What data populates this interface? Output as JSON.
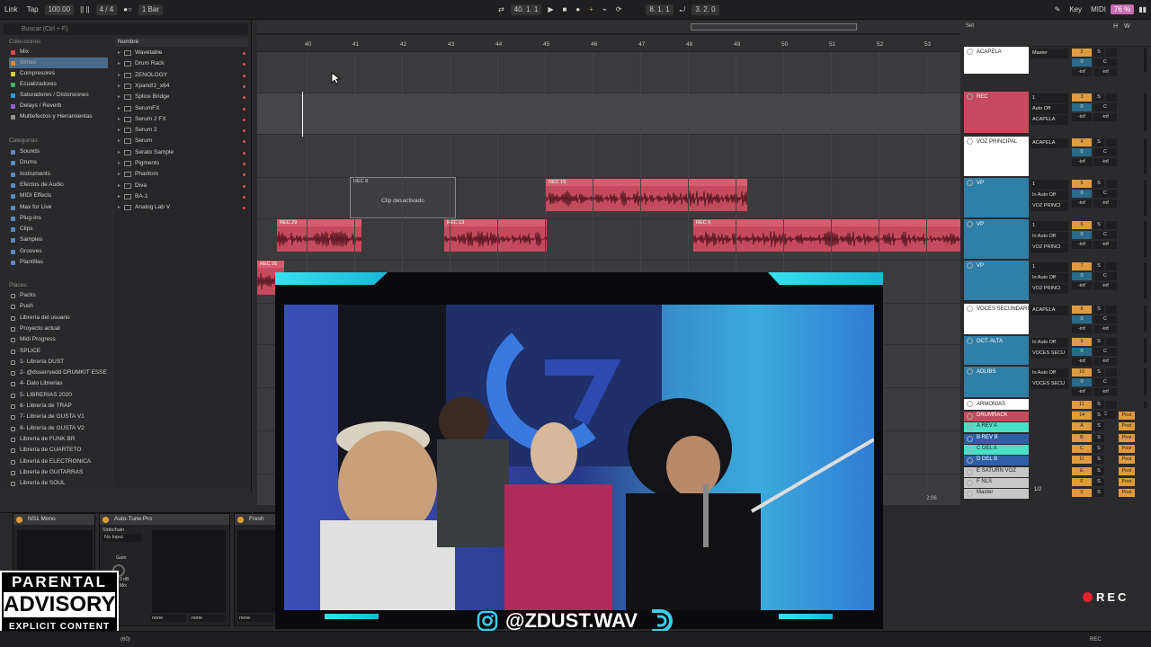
{
  "transport": {
    "link": "Link",
    "tap": "Tap",
    "bpm": "100.00",
    "sig": "4 / 4",
    "metro": "1 Bar",
    "position": "40.  1.  1",
    "loop_start": "8.  1.  1",
    "loop_len": "3.  2.  0",
    "key": "Key",
    "midi": "MIDI",
    "cpu": "76 %",
    "h": "H",
    "w": "W"
  },
  "browser": {
    "search_placeholder": "Buscar (Ctrl + F)",
    "collections_header": "Colecciones",
    "collections": [
      {
        "label": "Mix",
        "color": "#e04848"
      },
      {
        "label": "Sintes",
        "color": "#e08a30",
        "selected": true
      },
      {
        "label": "Compresores",
        "color": "#d8d040"
      },
      {
        "label": "Ecualizadores",
        "color": "#40b060"
      },
      {
        "label": "Saturadores / Distorsiones",
        "color": "#3098d8"
      },
      {
        "label": "Delays / Reverb",
        "color": "#9060d0"
      },
      {
        "label": "Multiefectos y Herramientas",
        "color": "#909090"
      }
    ],
    "categories_header": "Categorías",
    "categories": [
      "Sounds",
      "Drums",
      "Instruments",
      "Efectos de Audio",
      "MIDI Effects",
      "Max for Live",
      "Plug-Ins",
      "Clips",
      "Samples",
      "Grooves",
      "Plantillas"
    ],
    "places_header": "Places",
    "places": [
      "Packs",
      "Push",
      "Librería del usuario",
      "Proyecto actual",
      "Midi Progress",
      "SPLICE",
      "1- Librería DUST",
      "2- @dsserrvedd DRUMKIT ESSE",
      "4- Dalo Librerias",
      "5- LIBRERIAS 2020",
      "6- Librería de TRAP",
      "7- Librería de GUSTA V1",
      "8- Librería de GUSTA V2",
      "Librería de FUNK BR",
      "Librería de CUARTETO",
      "Librería de ELECTRONICA",
      "Librería de GUITARRAS",
      "Librería de SOUL"
    ],
    "name_header": "Nombre",
    "names": [
      "Wavetable",
      "Drum Rack",
      "ZENOLOGY",
      "Xpand!2_x64",
      "Splice Bridge",
      "SerumFX",
      "Serum 2 FX",
      "Serum 2",
      "Serum",
      "Serato Sample",
      "Pigments",
      "Phantom",
      "Diva",
      "BA-1",
      "Analog Lab V"
    ]
  },
  "arrangement": {
    "bars": [
      "40",
      "41",
      "42",
      "43",
      "44",
      "45",
      "46",
      "47",
      "48",
      "49",
      "50",
      "51",
      "52",
      "53"
    ],
    "clips": [
      {
        "name": "REC 8",
        "disabled": true,
        "message": "Clip desactivado"
      },
      {
        "name": "REC 15"
      },
      {
        "name": "REC 29"
      },
      {
        "name": "REC 13"
      },
      {
        "name": "REC 9"
      },
      {
        "name": "REC 26"
      }
    ],
    "time_marker": "2:06"
  },
  "mixer": {
    "set_label": "Set",
    "tracks": [
      {
        "name": "ACAPELA",
        "color": "#ffffff",
        "io": [
          "Master"
        ],
        "vol": "2"
      },
      {
        "name": "REC",
        "color": "#c64a5d",
        "io": [
          "1",
          "Auto  Off",
          "ACAPELA"
        ],
        "vol": "3"
      },
      {
        "name": "VOZ PRINCIPAL",
        "color": "#ffffff",
        "io": [
          "ACAPELA"
        ],
        "vol": "4"
      },
      {
        "name": "VP",
        "color": "#2f7fa8",
        "io": [
          "1",
          "In  Auto  Off",
          "VOZ PRINCI"
        ],
        "vol": "5"
      },
      {
        "name": "VP",
        "color": "#2f7fa8",
        "io": [
          "1",
          "In  Auto  Off",
          "VOZ PRINCI"
        ],
        "vol": "6"
      },
      {
        "name": "VP",
        "color": "#2f7fa8",
        "io": [
          "1",
          "In  Auto  Off",
          "VOZ PRINCI"
        ],
        "vol": "7"
      },
      {
        "name": "VOCES SECUNDARI",
        "color": "#ffffff",
        "io": [
          "ACAPELA"
        ],
        "vol": "8"
      },
      {
        "name": "OCT. ALTA",
        "color": "#2f7fa8",
        "io": [
          "In  Auto  Off",
          "VOCES SECU"
        ],
        "vol": "9"
      },
      {
        "name": "ADLIBS",
        "color": "#2f7fa8",
        "io": [
          "In  Auto  Off",
          "VOCES SECU"
        ],
        "vol": "10"
      },
      {
        "name": "ARMONIAS",
        "color": "#ffffff",
        "io": [],
        "vol": "11"
      }
    ],
    "returns": [
      {
        "name": "DRUMRACK",
        "color": "#c64a5d",
        "vol": "14"
      },
      {
        "name": "A REV A",
        "color": "#4ae0c8",
        "vol": "A"
      },
      {
        "name": "B REV B",
        "color": "#2f5fa8",
        "vol": "B"
      },
      {
        "name": "C DEL A",
        "color": "#4ae0c8",
        "vol": "C"
      },
      {
        "name": "D DEL B",
        "color": "#2f5fa8",
        "vol": "D"
      },
      {
        "name": "E SATURN VOZ",
        "color": "#c8c8c8",
        "vol": "E"
      },
      {
        "name": "F NLS",
        "color": "#c8c8c8",
        "vol": "F"
      },
      {
        "name": "Master",
        "color": "#c8c8c8",
        "vol": "0"
      }
    ],
    "master_io": "1/2",
    "inf": "-inf",
    "zero": "0",
    "c": "C",
    "s": "S",
    "post": "Post"
  },
  "devices": {
    "d1": "NS1 Mono",
    "d2": "Auto-Tune Pro",
    "d3": "Fresh",
    "sidechain": "Sidechain",
    "no_input": "No Input",
    "gain": "Gain",
    "none": "none",
    "db": "0 dB",
    "mix": "Mix"
  },
  "overlay": {
    "handle": "@ZDUST.WAV"
  },
  "advisory": {
    "l1": "PARENTAL",
    "l2": "ADVISORY",
    "l3": "EXPLICIT CONTENT"
  },
  "rec_label": "REC",
  "status": {
    "rec": "REC",
    "val": "(60)"
  }
}
